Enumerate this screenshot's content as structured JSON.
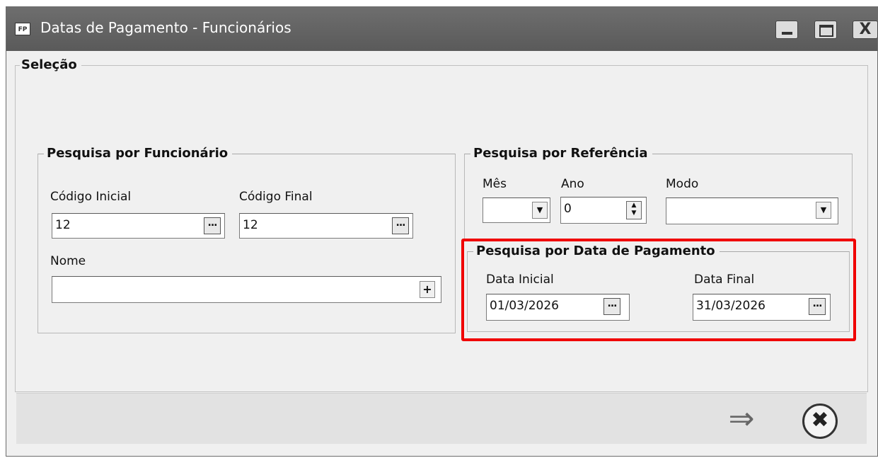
{
  "window": {
    "app_icon": "FP",
    "title": "Datas de Pagamento - Funcionários",
    "controls": {
      "minimize": "minimize-icon",
      "maximize": "maximize-icon",
      "close": "X"
    }
  },
  "selection": {
    "legend": "Seleção",
    "employee_search": {
      "legend": "Pesquisa por Funcionário",
      "code_start_label": "Código Inicial",
      "code_start_value": "12",
      "code_end_label": "Código Final",
      "code_end_value": "12",
      "name_label": "Nome",
      "name_value": "",
      "lookup_button": "...",
      "name_add_button": "+"
    },
    "reference_search": {
      "legend": "Pesquisa por Referência",
      "month_label": "Mês",
      "month_value": "",
      "year_label": "Ano",
      "year_value": "0",
      "mode_label": "Modo",
      "mode_value": ""
    },
    "payment_date_search": {
      "legend": "Pesquisa por Data de Pagamento",
      "start_label": "Data Inicial",
      "start_value": "01/03/2026",
      "end_label": "Data Final",
      "end_value": "31/03/2026",
      "highlight_color": "#f00000"
    }
  },
  "footer": {
    "next_icon": "⇒",
    "cancel_icon": "✖"
  }
}
